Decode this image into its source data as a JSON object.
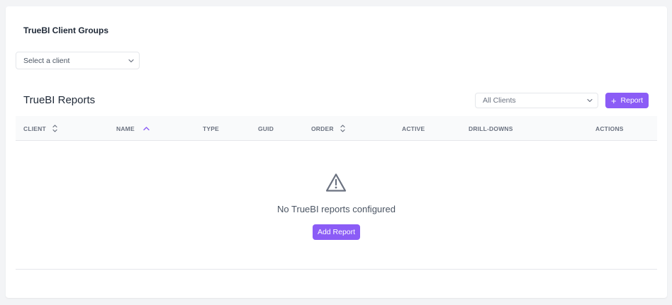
{
  "client_groups": {
    "title": "TrueBI Client Groups",
    "select_placeholder": "Select a client"
  },
  "reports": {
    "title": "TrueBI Reports",
    "filter_value": "All Clients",
    "add_button_label": "Report"
  },
  "table": {
    "columns": [
      {
        "label": "CLIENT",
        "sort": "both"
      },
      {
        "label": "NAME",
        "sort": "asc"
      },
      {
        "label": "TYPE",
        "sort": "none"
      },
      {
        "label": "GUID",
        "sort": "none"
      },
      {
        "label": "ORDER",
        "sort": "both"
      },
      {
        "label": "ACTIVE",
        "sort": "none"
      },
      {
        "label": "DRILL-DOWNS",
        "sort": "none"
      },
      {
        "label": "ACTIONS",
        "sort": "none"
      }
    ]
  },
  "empty_state": {
    "icon": "warning-triangle-icon",
    "message": "No TrueBI reports configured",
    "button_label": "Add Report"
  },
  "colors": {
    "accent": "#8b5cf6",
    "header_bg": "#f9fafb",
    "page_bg": "#f3f4f6",
    "icon_gray": "#6b7280"
  }
}
